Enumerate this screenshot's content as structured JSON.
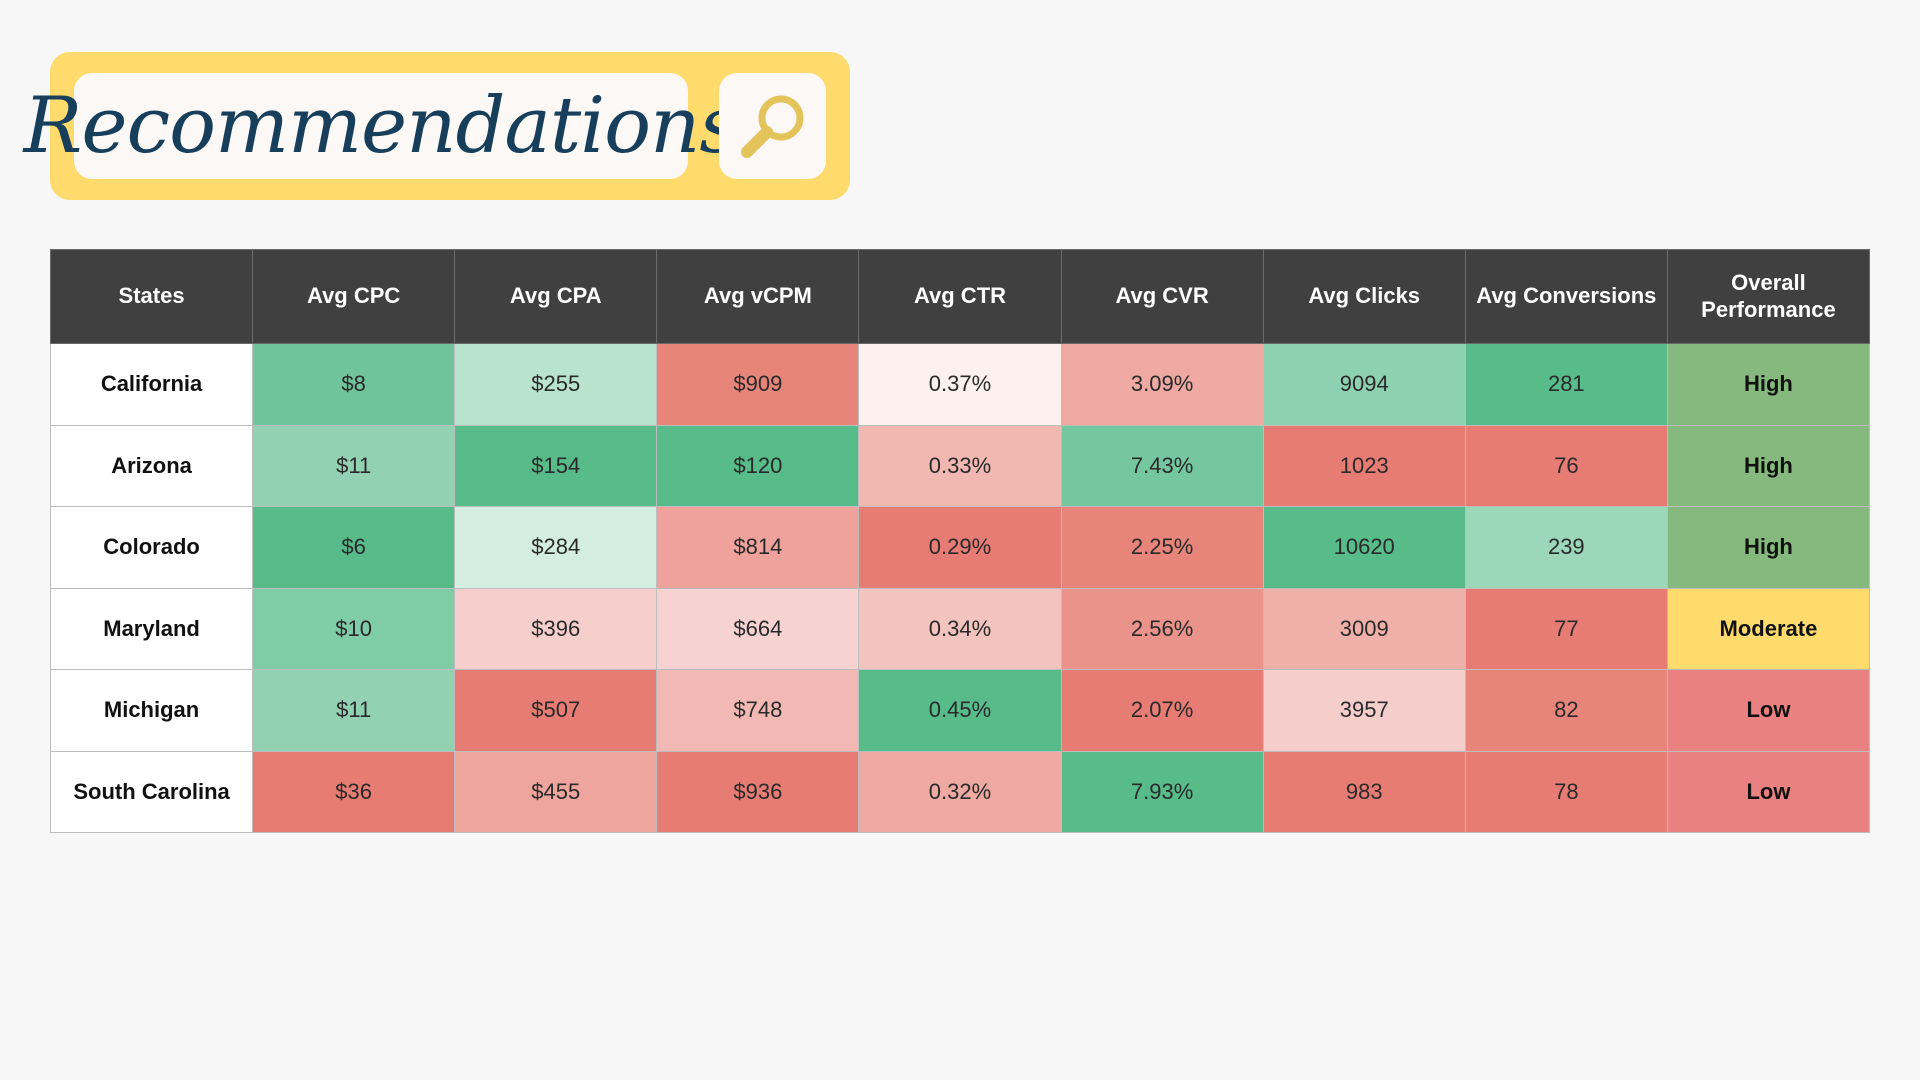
{
  "title": "Recommendations",
  "icon": "magnifier-icon",
  "colors": {
    "banner": "#fedb6c",
    "title_text": "#173f5c",
    "header_bg": "#404040",
    "icon": "#e2c45a"
  },
  "chart_data": {
    "type": "table",
    "columns": [
      "States",
      "Avg CPC",
      "Avg CPA",
      "Avg vCPM",
      "Avg CTR",
      "Avg CVR",
      "Avg Clicks",
      "Avg Conversions",
      "Overall Performance"
    ],
    "rows": [
      {
        "state": "California",
        "cells": [
          {
            "v": "$8",
            "bg": "#6fc49b"
          },
          {
            "v": "$255",
            "bg": "#b8e3cd"
          },
          {
            "v": "$909",
            "bg": "#e8857b"
          },
          {
            "v": "0.37%",
            "bg": "#fdf1ef"
          },
          {
            "v": "3.09%",
            "bg": "#eea9a2"
          },
          {
            "v": "9094",
            "bg": "#8ed1b0"
          },
          {
            "v": "281",
            "bg": "#57bb8a"
          }
        ],
        "performance": "High",
        "perf_bg": "#86b97d"
      },
      {
        "state": "Arizona",
        "cells": [
          {
            "v": "$11",
            "bg": "#92d2b2"
          },
          {
            "v": "$154",
            "bg": "#57bb8a"
          },
          {
            "v": "$120",
            "bg": "#57bb8a"
          },
          {
            "v": "0.33%",
            "bg": "#f1b7b1"
          },
          {
            "v": "7.43%",
            "bg": "#74c79e"
          },
          {
            "v": "1023",
            "bg": "#e67c73"
          },
          {
            "v": "76",
            "bg": "#e67c73"
          }
        ],
        "performance": "High",
        "perf_bg": "#86b97d"
      },
      {
        "state": "Colorado",
        "cells": [
          {
            "v": "$6",
            "bg": "#57bb8a"
          },
          {
            "v": "$284",
            "bg": "#d3eee0"
          },
          {
            "v": "$814",
            "bg": "#eea29b"
          },
          {
            "v": "0.29%",
            "bg": "#e67c73"
          },
          {
            "v": "2.25%",
            "bg": "#e8857b"
          },
          {
            "v": "10620",
            "bg": "#57bb8a"
          },
          {
            "v": "239",
            "bg": "#9bd7b8"
          }
        ],
        "performance": "High",
        "perf_bg": "#86b97d"
      },
      {
        "state": "Maryland",
        "cells": [
          {
            "v": "$10",
            "bg": "#80cca6"
          },
          {
            "v": "$396",
            "bg": "#f6cfcc"
          },
          {
            "v": "$664",
            "bg": "#f6d3d0"
          },
          {
            "v": "0.34%",
            "bg": "#f3c4bf"
          },
          {
            "v": "2.56%",
            "bg": "#ea938b"
          },
          {
            "v": "3009",
            "bg": "#f0b0aa"
          },
          {
            "v": "77",
            "bg": "#e67c73"
          }
        ],
        "performance": "Moderate",
        "perf_bg": "#fedb6c"
      },
      {
        "state": "Michigan",
        "cells": [
          {
            "v": "$11",
            "bg": "#92d2b2"
          },
          {
            "v": "$507",
            "bg": "#e67c73"
          },
          {
            "v": "$748",
            "bg": "#f2b9b4"
          },
          {
            "v": "0.45%",
            "bg": "#57bb8a"
          },
          {
            "v": "2.07%",
            "bg": "#e67c73"
          },
          {
            "v": "3957",
            "bg": "#f5cecb"
          },
          {
            "v": "82",
            "bg": "#e8857b"
          }
        ],
        "performance": "Low",
        "perf_bg": "#e98181"
      },
      {
        "state": "South Carolina",
        "cells": [
          {
            "v": "$36",
            "bg": "#e67c73"
          },
          {
            "v": "$455",
            "bg": "#eea59e"
          },
          {
            "v": "$936",
            "bg": "#e67c73"
          },
          {
            "v": "0.32%",
            "bg": "#eea9a2"
          },
          {
            "v": "7.93%",
            "bg": "#57bb8a"
          },
          {
            "v": "983",
            "bg": "#e67c73"
          },
          {
            "v": "78",
            "bg": "#e67c73"
          }
        ],
        "performance": "Low",
        "perf_bg": "#e98181"
      }
    ]
  }
}
